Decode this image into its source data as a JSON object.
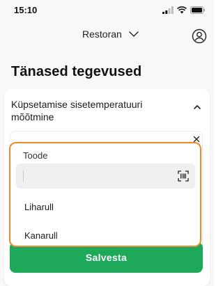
{
  "status_bar": {
    "time": "15:10"
  },
  "header": {
    "restaurant_label": "Restoran"
  },
  "page": {
    "title": "Tänased tegevused"
  },
  "card": {
    "title": "Küpsetamise sisetemperatuuri mõõtmine",
    "save_label": "Salvesta"
  },
  "dropdown": {
    "label": "Toode",
    "search_value": "",
    "options": [
      {
        "label": "Liharull"
      },
      {
        "label": "Kanarull"
      }
    ]
  },
  "colors": {
    "accent_green": "#1ea85a",
    "highlight_orange": "#ef8a2c"
  }
}
